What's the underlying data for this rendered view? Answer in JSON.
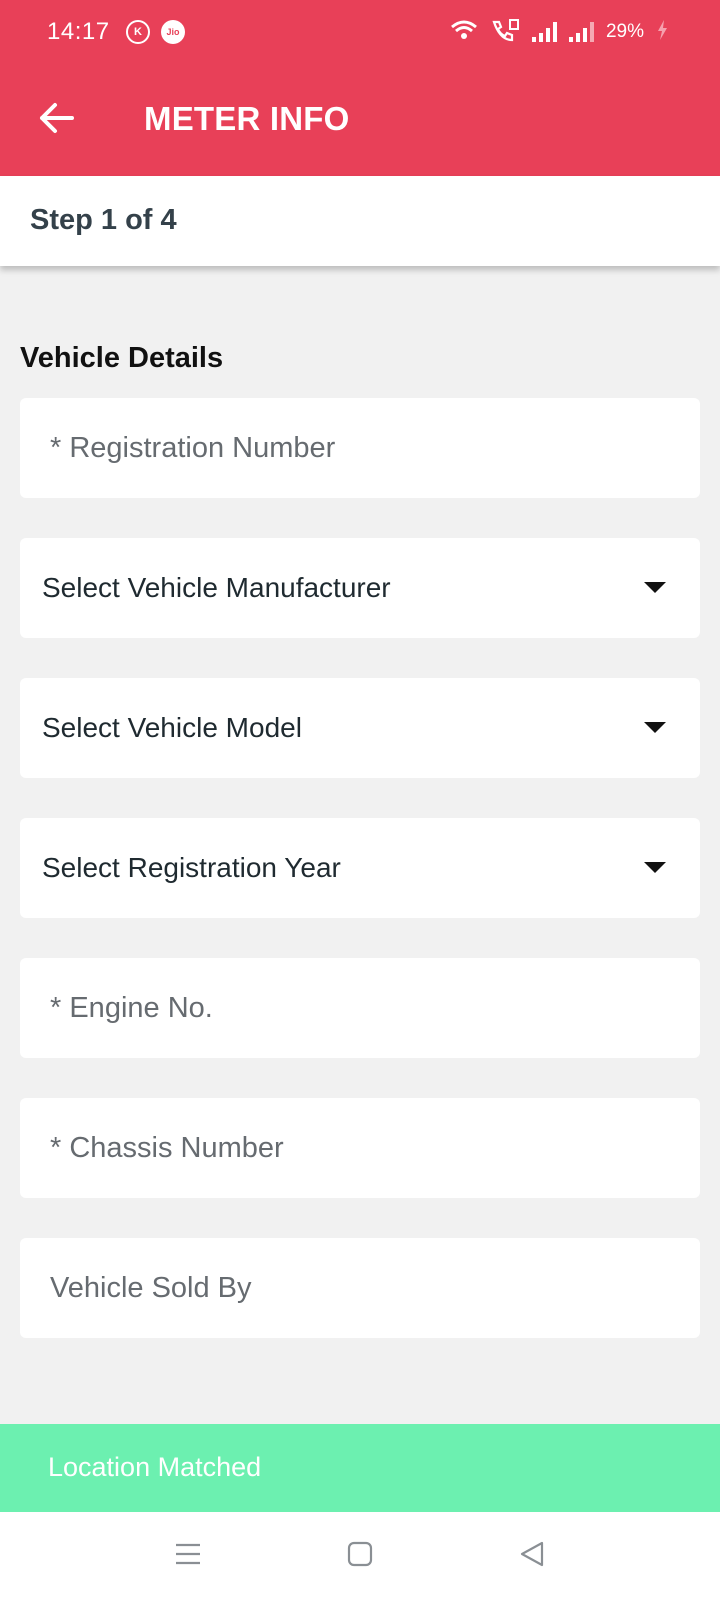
{
  "status_bar": {
    "time": "14:17",
    "carrier_badge_k": "K",
    "carrier_badge_jio": "Jio",
    "battery_percent": "29%",
    "icons": [
      "wifi-icon",
      "volte-icon",
      "signal-icon",
      "signal-icon",
      "charging-icon"
    ]
  },
  "header": {
    "title": "METER INFO",
    "back_icon": "arrow-left-icon",
    "background_color": "#e84058"
  },
  "stepper": {
    "label": "Step 1 of 4"
  },
  "form": {
    "section_title": "Vehicle Details",
    "registration_number": {
      "placeholder": "* Registration Number",
      "value": ""
    },
    "manufacturer": {
      "label": "Select Vehicle Manufacturer"
    },
    "model": {
      "label": "Select Vehicle Model"
    },
    "registration_year": {
      "label": "Select Registration Year"
    },
    "engine_no": {
      "placeholder": "* Engine No.",
      "value": ""
    },
    "chassis_number": {
      "placeholder": "* Chassis Number",
      "value": ""
    },
    "sold_by": {
      "placeholder": "Vehicle Sold By",
      "value": ""
    }
  },
  "banner": {
    "text": "Location Matched",
    "background_color": "#6cf0b0"
  },
  "nav_bar": {
    "icons": [
      "menu-icon",
      "home-square-icon",
      "back-triangle-icon"
    ]
  }
}
